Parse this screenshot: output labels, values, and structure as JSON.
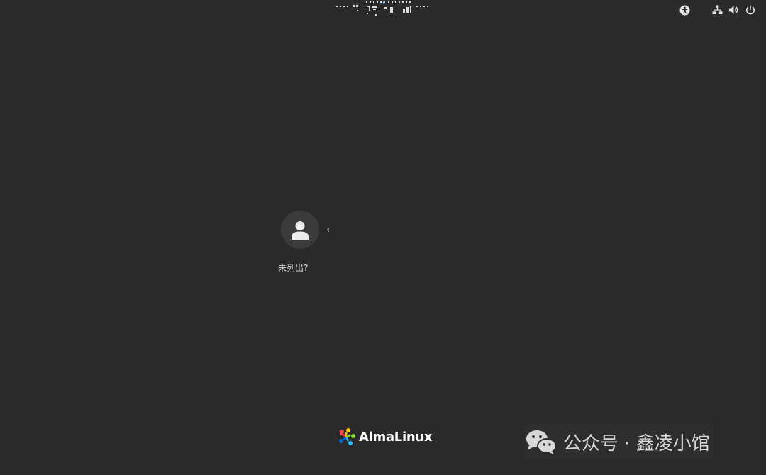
{
  "top_bar": {
    "clock": "",
    "status_icons": [
      "accessibility-icon",
      "network-icon",
      "volume-icon",
      "power-icon"
    ]
  },
  "login": {
    "user_name": "·:",
    "not_listed_label": "未列出?"
  },
  "brand": {
    "name": "AlmaLinux"
  },
  "watermark": {
    "text": "公众号 · 鑫凌小馆"
  },
  "colors": {
    "background": "#2a2a2a",
    "avatar_bg": "#3b3b3b",
    "text": "#d6d6d6"
  }
}
